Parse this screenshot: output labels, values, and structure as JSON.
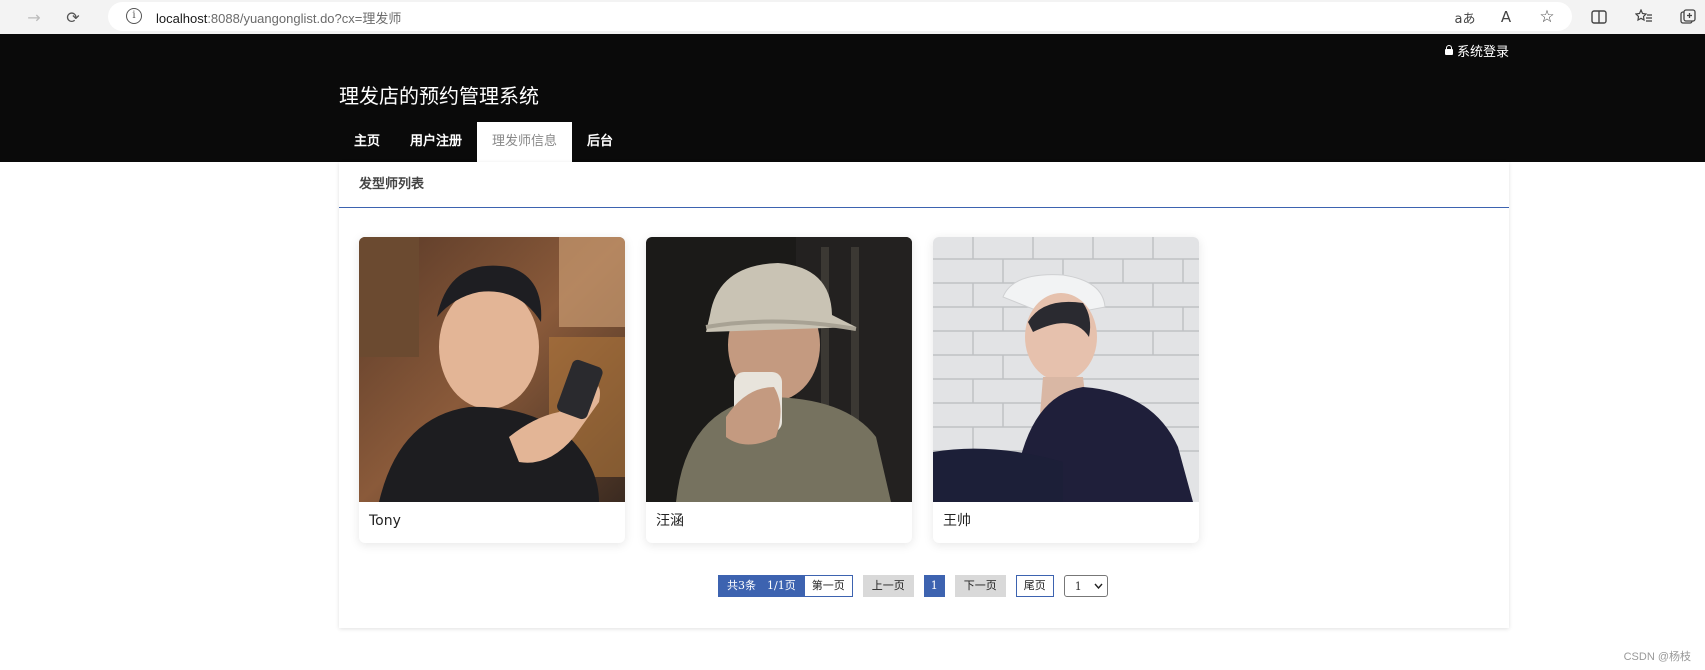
{
  "browser": {
    "url_host": "localhost",
    "url_rest": ":8088/yuangonglist.do?cx=理发师",
    "read_aloud_label": "aあ",
    "aa_label": "A"
  },
  "header": {
    "login_label": "系统登录",
    "site_title": "理发店的预约管理系统",
    "nav": [
      {
        "label": "主页"
      },
      {
        "label": "用户注册"
      },
      {
        "label": "理发师信息"
      },
      {
        "label": "后台"
      }
    ]
  },
  "panel": {
    "title": "发型师列表"
  },
  "cards": [
    {
      "name": "Tony",
      "photo_icon": "barber-photo"
    },
    {
      "name": "汪涵",
      "photo_icon": "barber-photo"
    },
    {
      "name": "王帅",
      "photo_icon": "barber-photo"
    }
  ],
  "pagination": {
    "total": "共3条",
    "pages": "1/1页",
    "first": "第一页",
    "prev": "上一页",
    "current": "1",
    "next": "下一页",
    "last": "尾页",
    "select_value": "1"
  },
  "watermark": "CSDN @杨枝",
  "colors": {
    "header_bg": "#0a0a0a",
    "accent": "#3d63b0"
  }
}
